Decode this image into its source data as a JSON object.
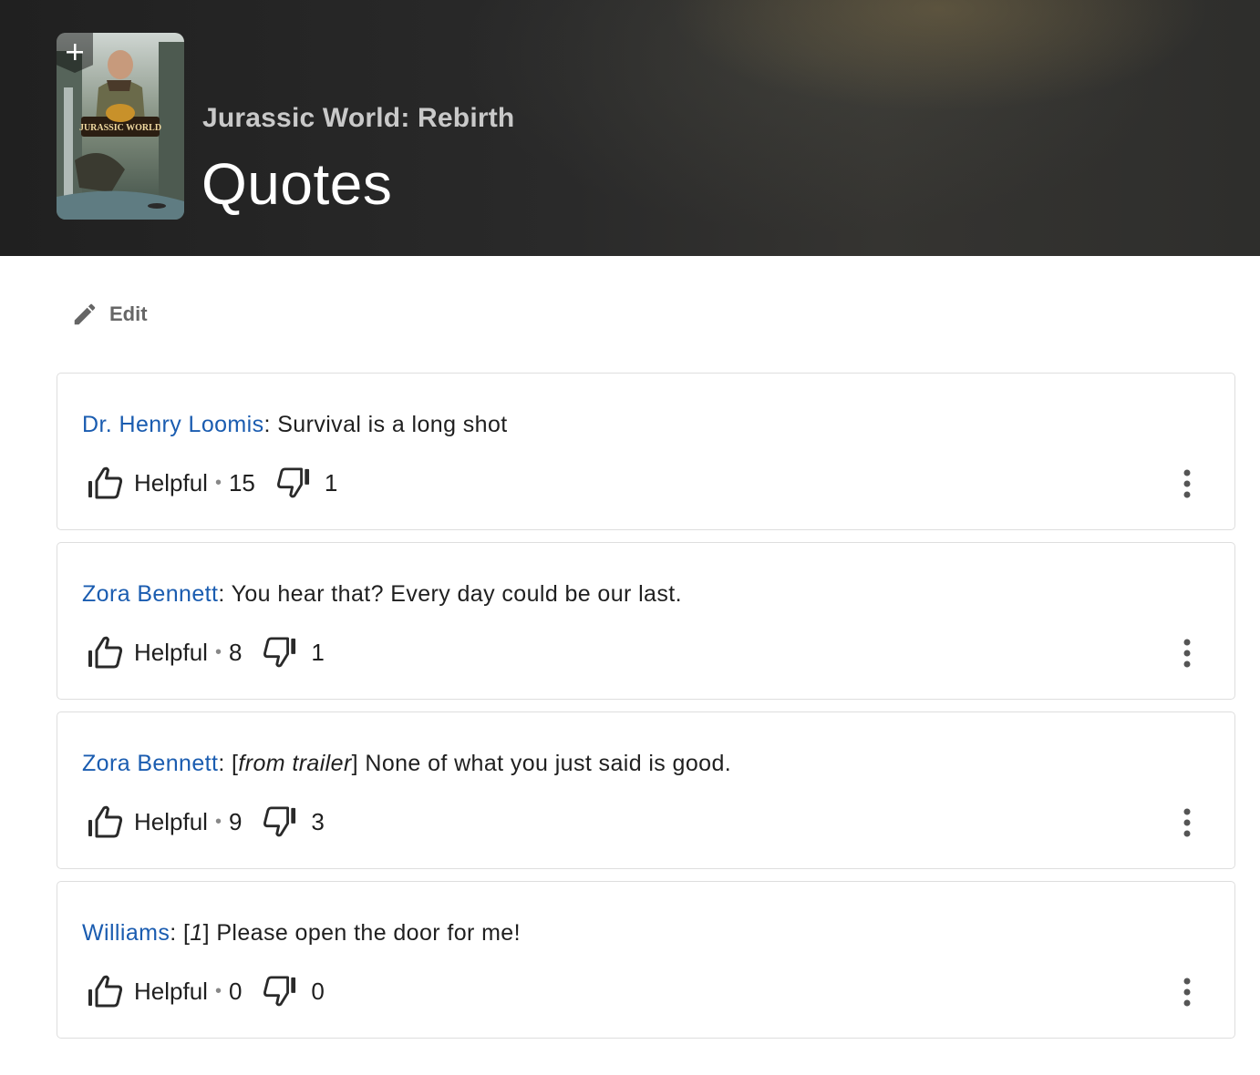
{
  "header": {
    "movie_title": "Jurassic World: Rebirth",
    "page_title": "Quotes",
    "poster_logo_text": "JURASSIC WORLD",
    "add_icon": "plus-icon"
  },
  "toolbar": {
    "edit_label": "Edit",
    "edit_icon": "pencil-icon"
  },
  "quotes": [
    {
      "character": "Dr. Henry Loomis",
      "separator": ": ",
      "pre": "",
      "italic": "",
      "post": "",
      "text": "Survival is a long shot",
      "helpful_label": "Helpful",
      "helpful_count": "15",
      "unhelpful_count": "1"
    },
    {
      "character": "Zora Bennett",
      "separator": ": ",
      "pre": "",
      "italic": "",
      "post": "",
      "text": "You hear that? Every day could be our last.",
      "helpful_label": "Helpful",
      "helpful_count": "8",
      "unhelpful_count": "1"
    },
    {
      "character": "Zora Bennett",
      "separator": ": ",
      "pre": "[",
      "italic": "from trailer",
      "post": "] ",
      "text": "None of what you just said is good.",
      "helpful_label": "Helpful",
      "helpful_count": "9",
      "unhelpful_count": "3"
    },
    {
      "character": "Williams",
      "separator": ": ",
      "pre": "[",
      "italic": "1",
      "post": "] ",
      "text": "Please open the door for me!",
      "helpful_label": "Helpful",
      "helpful_count": "0",
      "unhelpful_count": "0"
    }
  ],
  "colors": {
    "link": "#1a5cb0",
    "text": "#1f1f1f",
    "muted": "#666666",
    "hero_bg": "#2a2a2a"
  }
}
